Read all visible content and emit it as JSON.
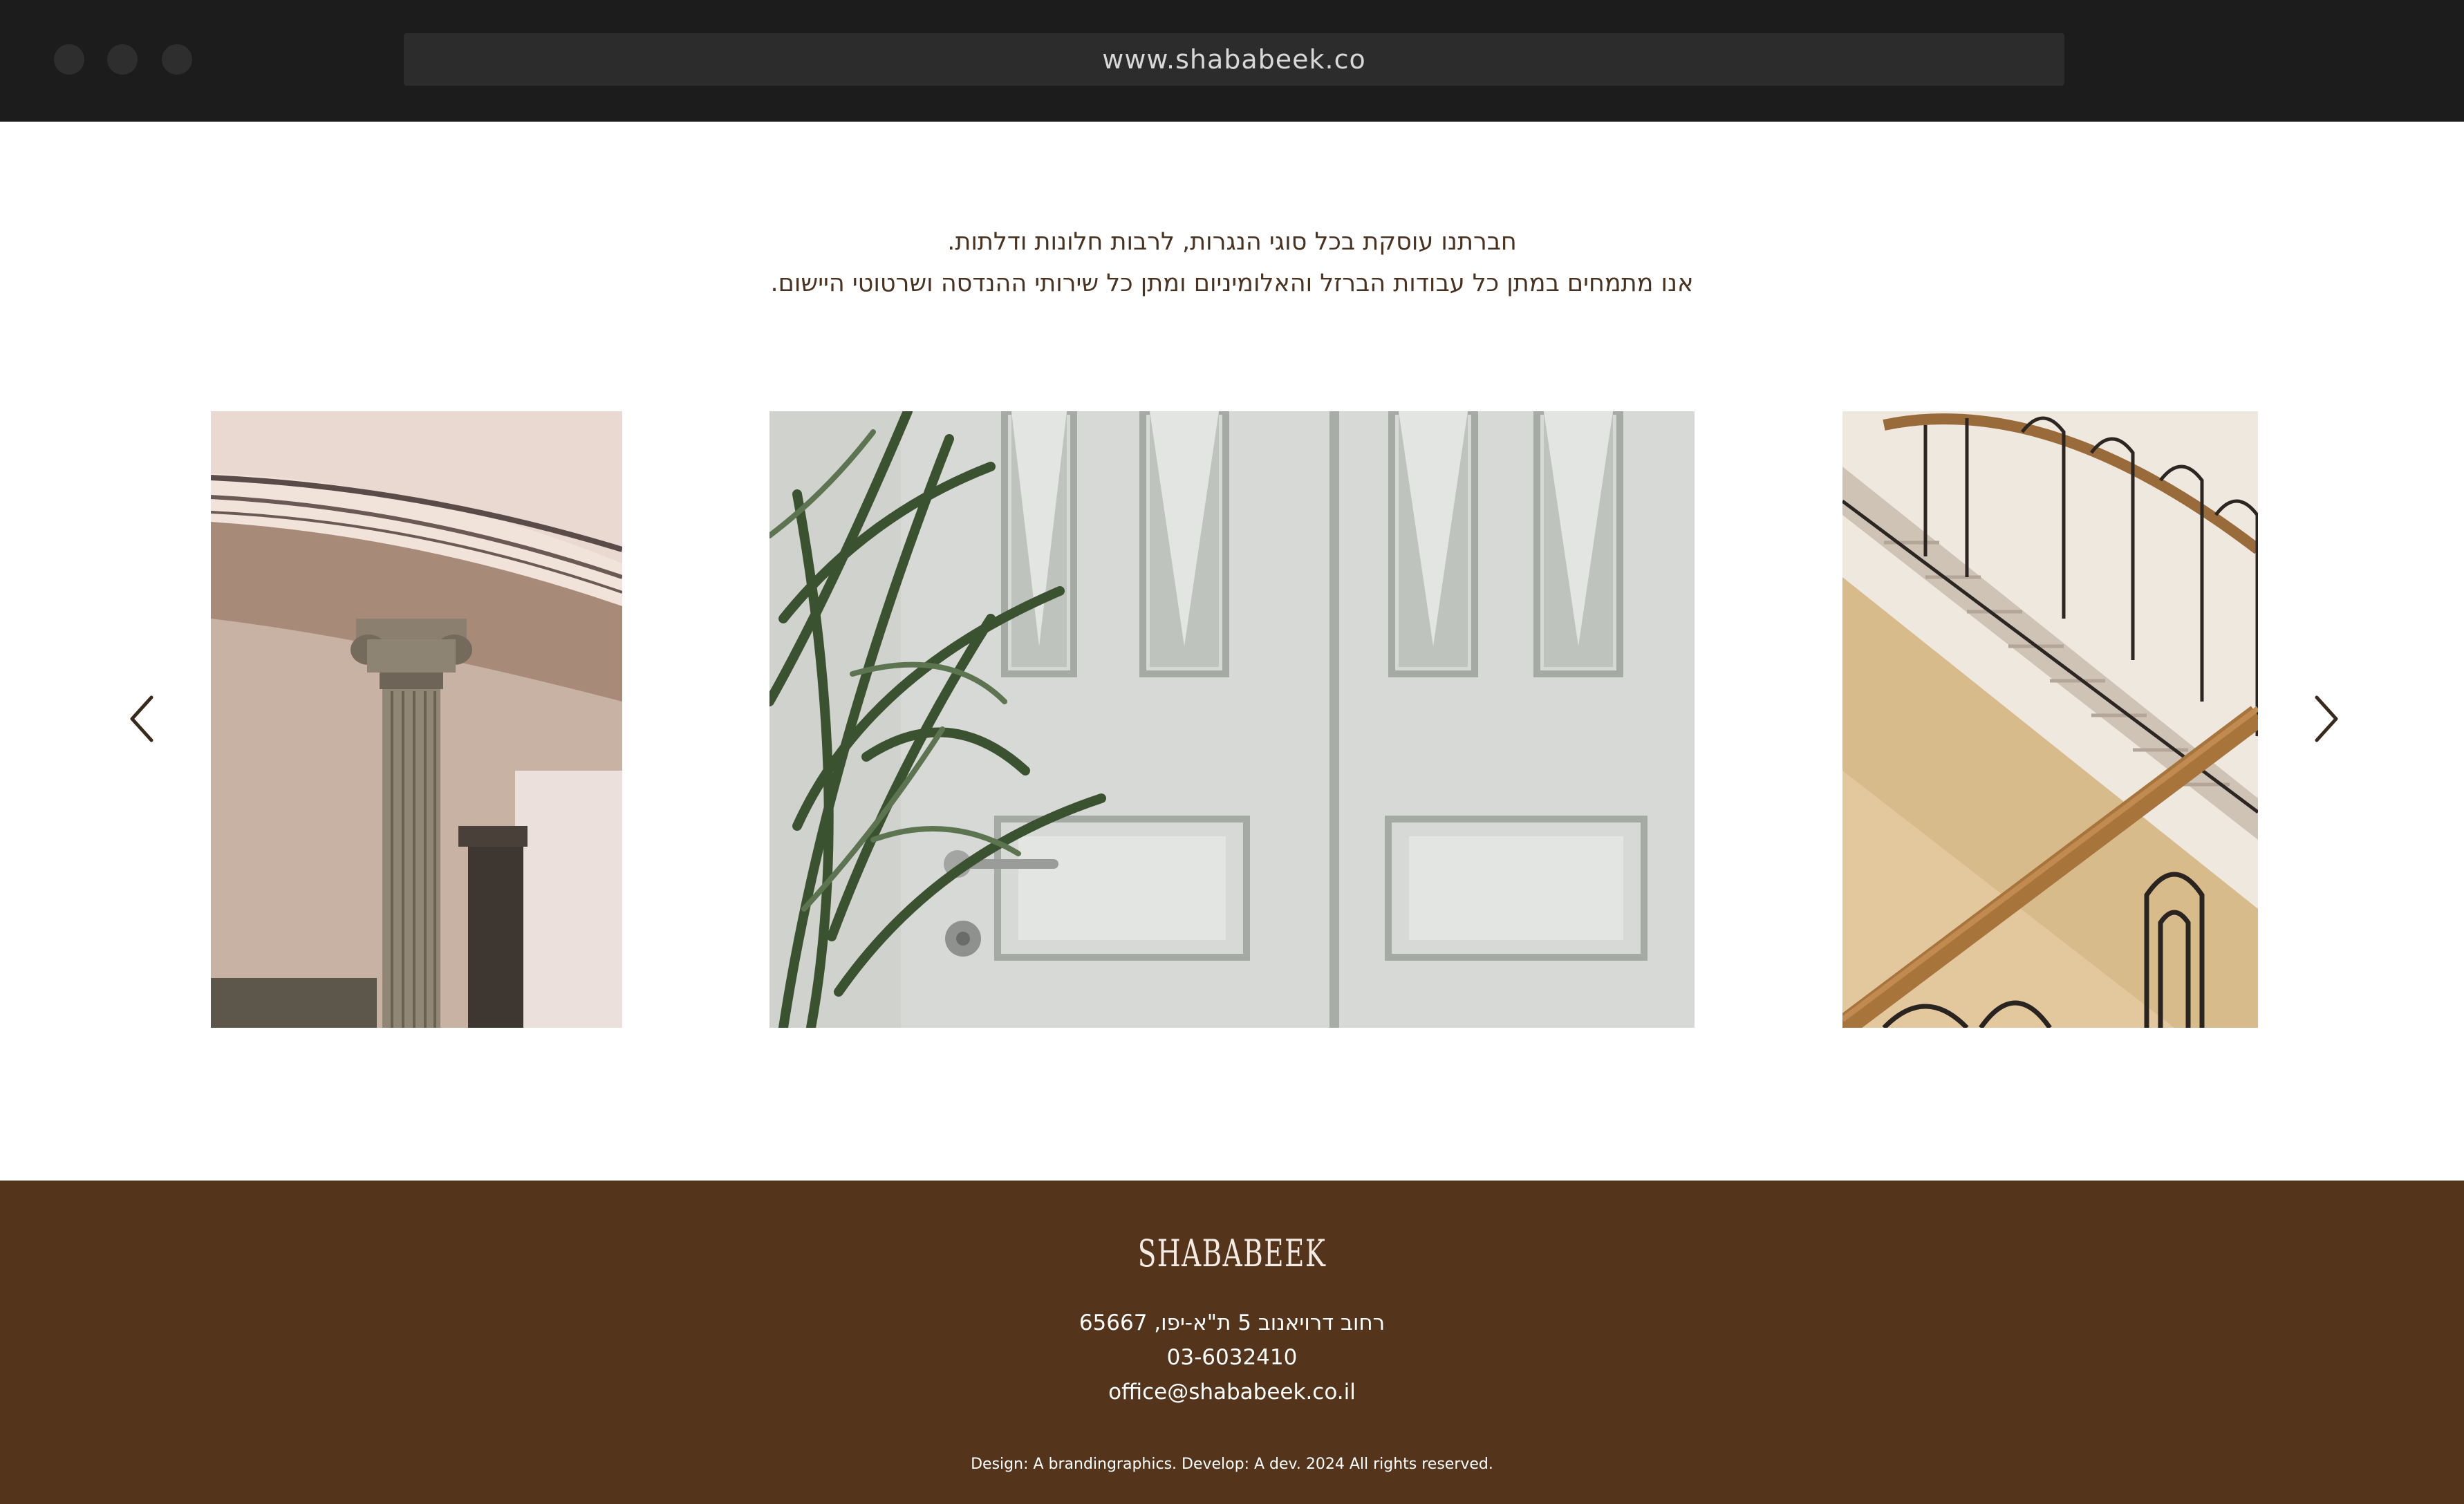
{
  "browser": {
    "url": "www.shababeek.co"
  },
  "intro": {
    "line1": "חברתנו עוסקת בכל סוגי הנגרות, לרבות חלונות ודלתות.",
    "line2": "אנו מתמחים במתן כל עבודות הברזל והאלומיניום ומתן כל שירותי ההנדסה ושרטוטי היישום."
  },
  "gallery": {
    "prev_icon": "chevron-left-icon",
    "next_icon": "chevron-right-icon",
    "arrow_color": "#3a2a1c"
  },
  "footer": {
    "logo": "SHABABEEK",
    "address": "רחוב דרויאנוב 5 ת\"א-יפו, 65667",
    "phone": "03-6032410",
    "email": "office@shababeek.co.il",
    "credits": "Design: A brandingraphics. Develop: A dev. 2024 All rights reserved.",
    "background": "#54351c"
  }
}
